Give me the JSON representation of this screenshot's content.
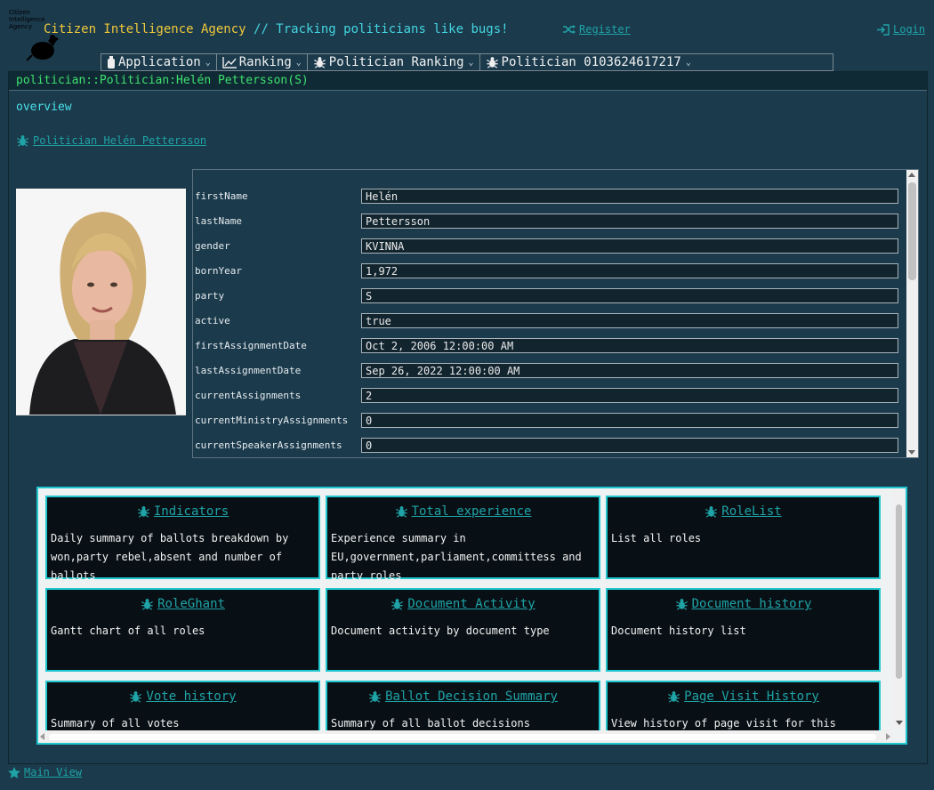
{
  "header": {
    "logo_text": "Citizen Intelligence Agency",
    "title": "Citizen Intelligence Agency",
    "subtitle": "// Tracking politicians like bugs!",
    "register_label": "Register",
    "register_icon": "shuffle-icon",
    "login_label": "Login",
    "login_icon": "sign-in-icon"
  },
  "menu": {
    "items": [
      {
        "label": "Application",
        "icon": "bottle-icon"
      },
      {
        "label": "Ranking",
        "icon": "line-chart-icon"
      },
      {
        "label": "Politician Ranking",
        "icon": "bug-icon"
      },
      {
        "label": "Politician 0103624617217",
        "icon": "bug-icon"
      }
    ]
  },
  "panel": {
    "header": "politician::Politician:Helén Pettersson(S)",
    "section_title": "overview",
    "politician_link": "Politician Helén Pettersson"
  },
  "form": {
    "fields": [
      {
        "label": "firstName",
        "value": "Helén"
      },
      {
        "label": "lastName",
        "value": "Pettersson"
      },
      {
        "label": "gender",
        "value": "KVINNA"
      },
      {
        "label": "bornYear",
        "value": "1,972"
      },
      {
        "label": "party",
        "value": "S"
      },
      {
        "label": "active",
        "value": "true"
      },
      {
        "label": "firstAssignmentDate",
        "value": "Oct 2, 2006 12:00:00 AM"
      },
      {
        "label": "lastAssignmentDate",
        "value": "Sep 26, 2022 12:00:00 AM"
      },
      {
        "label": "currentAssignments",
        "value": "2"
      },
      {
        "label": "currentMinistryAssignments",
        "value": "0"
      },
      {
        "label": "currentSpeakerAssignments",
        "value": "0"
      }
    ]
  },
  "cards": [
    {
      "title": "Indicators",
      "desc": "Daily summary of ballots breakdown by won,party rebel,absent and number of ballots"
    },
    {
      "title": "Total experience",
      "desc": "Experience summary in EU,government,parliament,committess and party roles"
    },
    {
      "title": "RoleList",
      "desc": "List all roles"
    },
    {
      "title": "RoleGhant",
      "desc": "Gantt chart of all roles"
    },
    {
      "title": "Document Activity",
      "desc": "Document activity by document type"
    },
    {
      "title": "Document history",
      "desc": "Document history list"
    },
    {
      "title": "Vote history",
      "desc": "Summary of all votes"
    },
    {
      "title": "Ballot Decision Summary",
      "desc": "Summary of all ballot decisions"
    },
    {
      "title": "Page Visit History",
      "desc": "View history of page visit for this page."
    }
  ],
  "footer": {
    "main_view_label": "Main View",
    "main_view_icon": "star-icon"
  },
  "colors": {
    "background": "#1b3a4c",
    "accent_cyan": "#21c7cf",
    "link": "#1fa3a6",
    "title_yellow": "#f0c93a",
    "header_green": "#3ee06e"
  }
}
